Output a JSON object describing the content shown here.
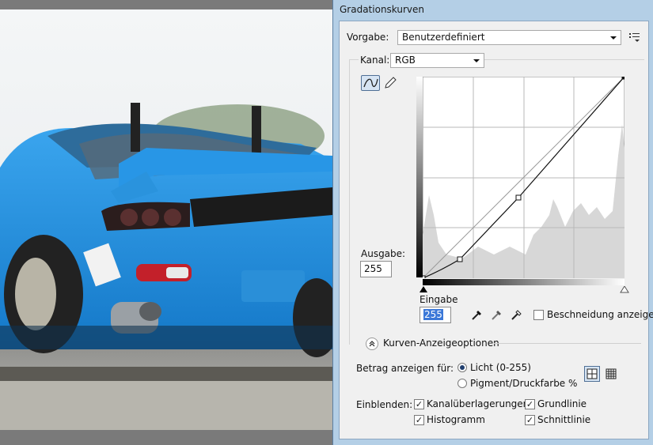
{
  "dialog": {
    "title": "Gradationskurven",
    "preset_label": "Vorgabe:",
    "preset_value": "Benutzerdefiniert",
    "channel_label": "Kanal:",
    "channel_value": "RGB",
    "output_label": "Ausgabe:",
    "output_value": "255",
    "input_label": "Eingabe",
    "input_value": "255",
    "clipping_label": "Beschneidung anzeigen",
    "curve_options_label": "Kurven-Anzeigeoptionen",
    "show_amount_label": "Betrag anzeigen für:",
    "light_label": "Licht (0-255)",
    "pigment_label": "Pigment/Druckfarbe %",
    "show_label": "Einblenden:",
    "channel_overlays_label": "Kanalüberlagerungen",
    "baseline_label": "Grundlinie",
    "histogram_label": "Histogramm",
    "intersection_label": "Schnittlinie"
  },
  "state": {
    "light_selected": true,
    "pigment_selected": false,
    "clipping_checked": false,
    "channel_overlays_checked": true,
    "baseline_checked": true,
    "histogram_checked": true,
    "intersection_checked": true
  },
  "curve": {
    "points": [
      [
        0,
        0
      ],
      [
        47,
        24
      ],
      [
        121,
        102
      ],
      [
        255,
        255
      ]
    ]
  },
  "icons": {
    "curve_tool": "curve-point-icon",
    "pencil_tool": "pencil-icon",
    "menu": "panel-menu-icon",
    "black_eyedropper": "eyedropper-black-icon",
    "gray_eyedropper": "eyedropper-gray-icon",
    "white_eyedropper": "eyedropper-white-icon",
    "expand": "expand-up-icon",
    "grid_coarse": "grid-4x4-icon",
    "grid_fine": "grid-10x10-icon"
  }
}
